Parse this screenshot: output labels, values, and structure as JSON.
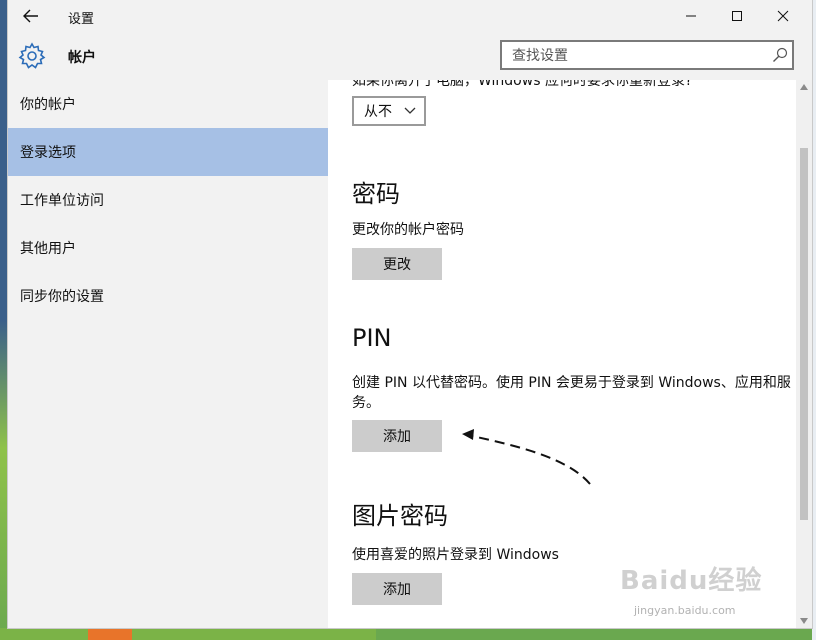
{
  "window": {
    "title": "设置",
    "back_icon": "back-arrow-icon",
    "controls": {
      "minimize_icon": "minimize-icon",
      "maximize_icon": "maximize-icon",
      "close_icon": "close-icon"
    }
  },
  "header": {
    "title": "帐户",
    "icon": "gear-icon",
    "search": {
      "placeholder": "查找设置",
      "icon": "search-icon"
    }
  },
  "sidebar": {
    "items": [
      {
        "label": "你的帐户",
        "active": false
      },
      {
        "label": "登录选项",
        "active": true
      },
      {
        "label": "工作单位访问",
        "active": false
      },
      {
        "label": "其他用户",
        "active": false
      },
      {
        "label": "同步你的设置",
        "active": false
      }
    ],
    "active_color": "#a6c0e5"
  },
  "content": {
    "cut_off_text": "如果你离开了电脑，Windows 应何时要求你重新登录?",
    "require_signin": {
      "selected": "从不"
    },
    "password": {
      "title": "密码",
      "description": "更改你的帐户密码",
      "button": "更改"
    },
    "pin": {
      "title": "PIN",
      "description": "创建 PIN 以代替密码。使用 PIN 会更易于登录到 Windows、应用和服务。",
      "button": "添加"
    },
    "picture_password": {
      "title": "图片密码",
      "description": "使用喜爱的照片登录到 Windows",
      "button": "添加"
    }
  },
  "watermark": {
    "main": "Baidu经验",
    "sub": "jingyan.baidu.com"
  }
}
